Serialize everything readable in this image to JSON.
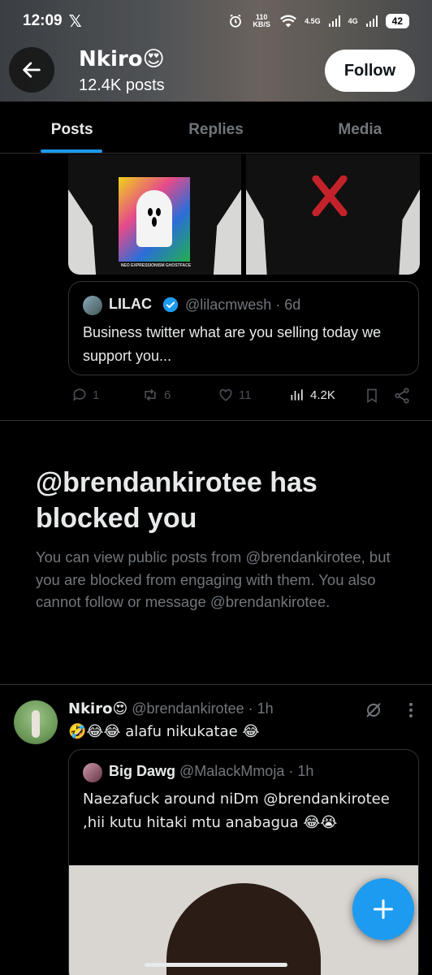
{
  "status_bar": {
    "time": "12:09",
    "network_speed": "110 KB/S",
    "signal_1": "4.5G",
    "signal_2": "4G",
    "battery": "42"
  },
  "header": {
    "name": "Nkiro😍",
    "post_count": "12.4K posts",
    "follow_label": "Follow"
  },
  "tabs": [
    {
      "label": "Posts",
      "active": true
    },
    {
      "label": "Replies",
      "active": false
    },
    {
      "label": "Media",
      "active": false
    }
  ],
  "post_1": {
    "print_caption": "NEO EXPRESSIONISM GHOSTFACE",
    "quote": {
      "name": "LILAC",
      "handle_time": "@lilacmwesh · 6d",
      "text": "Business twitter what are you selling today we support you..."
    },
    "actions": {
      "replies": "1",
      "reposts": "6",
      "likes": "11",
      "views": "4.2K"
    }
  },
  "blocked_notice": {
    "title": "@brendankirotee has blocked you",
    "description": "You can view public posts from @brendankirotee, but you are blocked from engaging with them. You also cannot follow or message @brendankirotee."
  },
  "post_2": {
    "name": "Nkiro😍",
    "handle_time": "@brendankirotee · 1h",
    "text": "🤣😂😂 alafu nikukatae 😂",
    "quote": {
      "name": "Big Dawg",
      "handle_time": "@MalackMmoja · 1h",
      "text": "Naezafuck around niDm @brendankirotee ,hii kutu hitaki mtu anabagua 😂😭"
    }
  },
  "colors": {
    "accent": "#1d9bf0",
    "background": "#000000",
    "muted_text": "#71767b",
    "border": "#2f3336"
  }
}
